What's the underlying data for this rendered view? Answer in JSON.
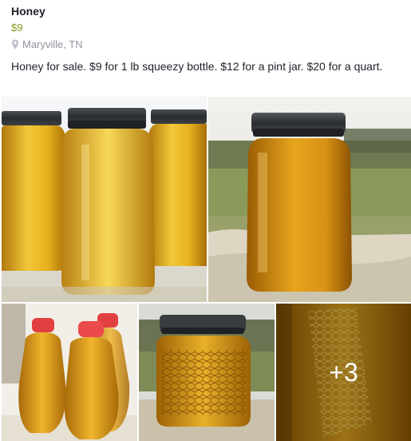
{
  "listing": {
    "title": "Honey",
    "price": "$9",
    "location": "Maryville, TN",
    "location_icon": "map-pin-icon",
    "description": "Honey for sale. $9 for 1 lb squeezy bottle. $12 for a pint jar. $20 for a quart."
  },
  "photos": {
    "more_count": "+3"
  },
  "colors": {
    "price": "#7f9a1f",
    "location": "#90949c",
    "text": "#1d2129"
  }
}
